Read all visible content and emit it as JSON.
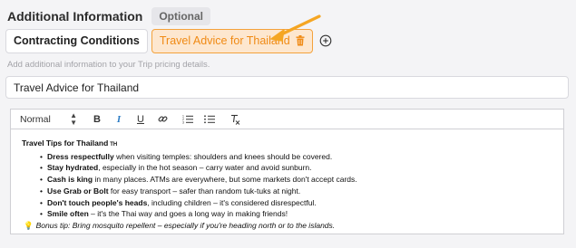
{
  "section": {
    "title": "Additional Information",
    "optional_label": "Optional"
  },
  "tabs": [
    {
      "label": "Contracting Conditions",
      "active": false
    },
    {
      "label": "Travel Advice for Thailand",
      "active": true
    }
  ],
  "helper_text": "Add additional information to your Trip pricing details.",
  "title_input": {
    "value": "Travel Advice for Thailand"
  },
  "toolbar": {
    "format_value": "Normal",
    "bold": "B",
    "italic": "I",
    "underline": "U",
    "clear_format": "T"
  },
  "content": {
    "heading": "Travel Tips for Thailand",
    "heading_flag": "TH",
    "tips": [
      {
        "bold": "Dress respectfully",
        "rest": " when visiting temples: shoulders and knees should be covered."
      },
      {
        "bold": "Stay hydrated",
        "rest": ", especially in the hot season – carry water and avoid sunburn."
      },
      {
        "bold": "Cash is king",
        "rest": " in many places. ATMs are everywhere, but some markets don't accept cards."
      },
      {
        "bold": "Use Grab or Bolt",
        "rest": " for easy transport – safer than random tuk-tuks at night."
      },
      {
        "bold": "Don't touch people's heads",
        "rest": ", including children – it's considered disrespectful."
      },
      {
        "bold": "Smile often",
        "rest": " – it's the Thai way and goes a long way in making friends!"
      }
    ],
    "bonus": "Bonus tip: Bring mosquito repellent – especially if you're heading north or to the islands."
  },
  "colors": {
    "accent": "#f08a14",
    "accent_bg": "#fde7cf",
    "arrow": "#f5a623"
  }
}
